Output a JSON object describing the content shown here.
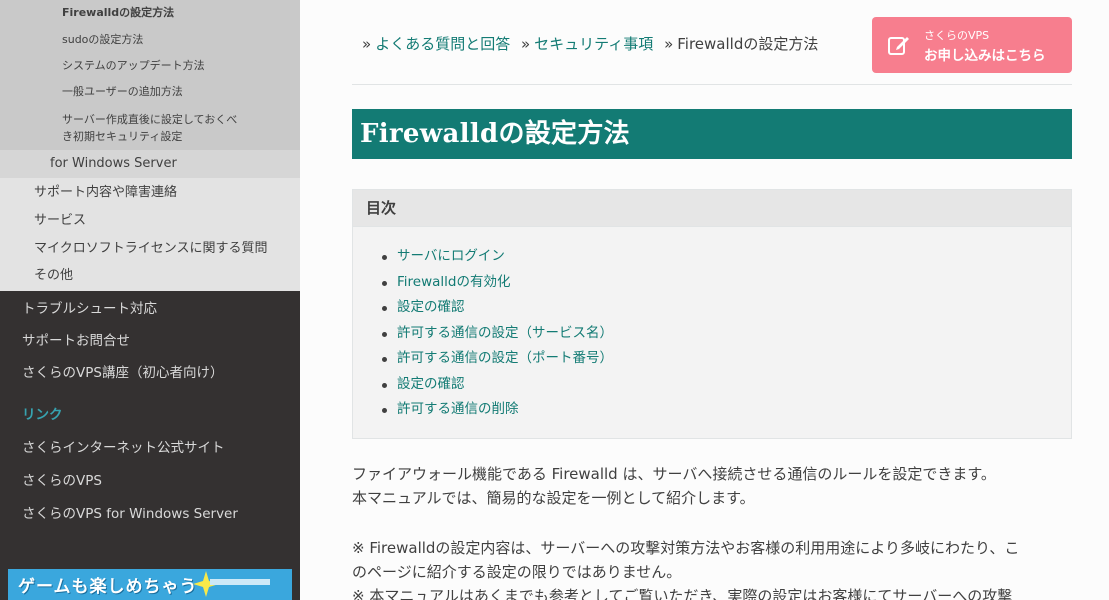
{
  "sidebar": {
    "l3_items": [
      {
        "label": "Firewalldの設定方法",
        "current": true
      },
      {
        "label": "sudoの設定方法"
      },
      {
        "label": "システムのアップデート方法"
      },
      {
        "label": "一般ユーザーの追加方法"
      },
      {
        "label": "サーバー作成直後に設定しておくべき初期セキュリティ設定"
      }
    ],
    "l2_winserver": "for Windows Server",
    "l2_items": [
      "サポート内容や障害連絡",
      "サービス",
      "マイクロソフトライセンスに関する質問",
      "その他"
    ],
    "l1_items": [
      "トラブルシュート対応",
      "サポートお問合せ",
      "さくらのVPS講座（初心者向け）"
    ],
    "caption": "リンク",
    "link_items": [
      "さくらインターネット公式サイト",
      "さくらのVPS",
      "さくらのVPS for Windows Server"
    ],
    "banner_text": "ゲームも楽しめちゃう"
  },
  "breadcrumb": {
    "items": [
      "よくある質問と回答",
      "セキュリティ事項"
    ],
    "current": "Firewalldの設定方法",
    "separator": "»"
  },
  "apply_button": {
    "small": "さくらのVPS",
    "big": "お申し込みはこちら",
    "icon": "pen-edit-icon"
  },
  "page_title": "Firewalldの設定方法",
  "toc": {
    "heading": "目次",
    "items": [
      "サーバにログイン",
      "Firewalldの有効化",
      "設定の確認",
      "許可する通信の設定（サービス名）",
      "許可する通信の設定（ポート番号）",
      "設定の確認",
      "許可する通信の削除"
    ]
  },
  "body": {
    "p1_line1": "ファイアウォール機能である Firewalld は、サーバへ接続させる通信のルールを設定できます。",
    "p1_line2": "本マニュアルでは、簡易的な設定を一例として紹介します。",
    "p2_line1": "※ Firewalldの設定内容は、サーバーへの攻撃対策方法やお客様の利用用途により多岐にわたり、こ",
    "p2_line2": "のページに紹介する設定の限りではありません。",
    "p3_line1": "※ 本マニュアルはあくまでも参考としてご覧いただき、実際の設定はお客様にてサーバーへの攻撃"
  },
  "colors": {
    "accent": "#137b74",
    "sidebar_bg": "#343131",
    "button": "#f77e8e",
    "caption": "#37a3b0"
  }
}
